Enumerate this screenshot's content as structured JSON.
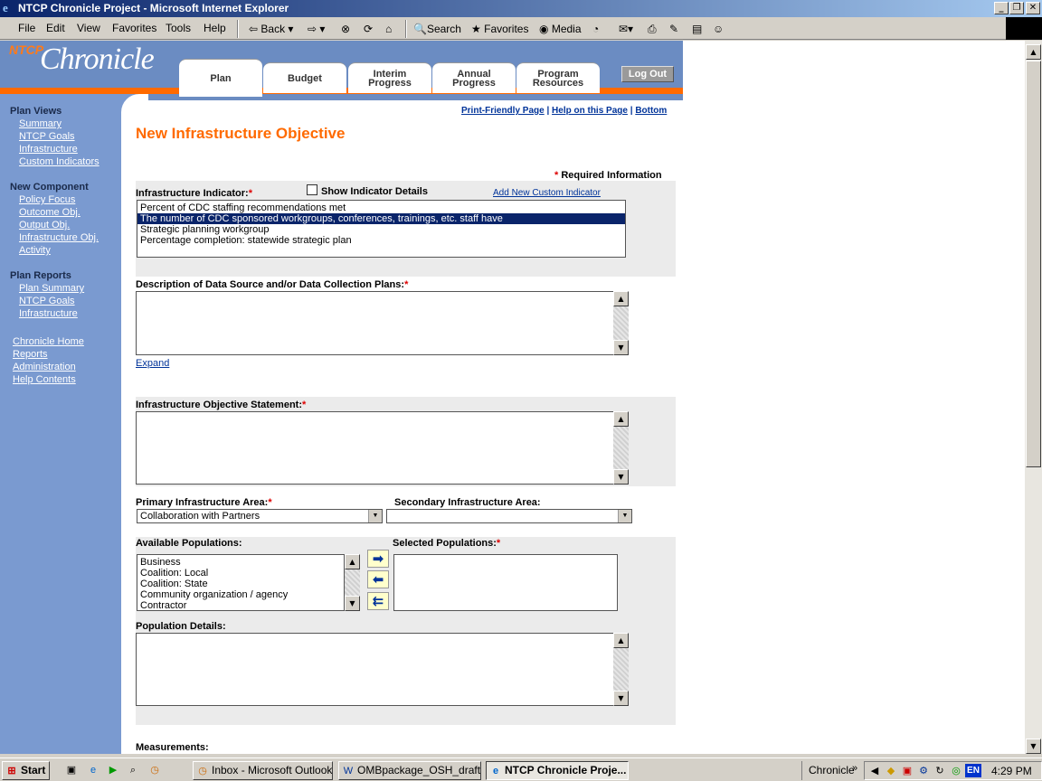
{
  "window": {
    "title": "NTCP Chronicle Project - Microsoft Internet Explorer"
  },
  "menu": [
    "File",
    "Edit",
    "View",
    "Favorites",
    "Tools",
    "Help"
  ],
  "toolbar": {
    "back": "Back",
    "search": "Search",
    "favorites": "Favorites",
    "media": "Media"
  },
  "header": {
    "logo_ntcp": "NTCP",
    "logo_chronicle": "Chronicle",
    "tabs": [
      {
        "line1": "Plan",
        "line2": ""
      },
      {
        "line1": "Budget",
        "line2": ""
      },
      {
        "line1": "Interim",
        "line2": "Progress"
      },
      {
        "line1": "Annual",
        "line2": "Progress"
      },
      {
        "line1": "Program",
        "line2": "Resources"
      }
    ],
    "logout": "Log Out"
  },
  "sidebar": {
    "plan_views": "Plan Views",
    "pv_items": [
      "Summary",
      "NTCP Goals",
      "Infrastructure",
      "Custom Indicators"
    ],
    "new_component": "New Component",
    "nc_items": [
      "Policy Focus",
      "Outcome Obj.",
      "Output Obj.",
      "Infrastructure Obj.",
      "Activity"
    ],
    "plan_reports": "Plan Reports",
    "pr_items": [
      "Plan Summary",
      "NTCP Goals",
      "Infrastructure"
    ],
    "bottom_items": [
      "Chronicle Home",
      "Reports",
      "Administration",
      "Help Contents"
    ]
  },
  "toplinks": {
    "print": "Print-Friendly Page",
    "help": "Help on this Page",
    "bottom": "Bottom"
  },
  "page": {
    "title": "New Infrastructure Objective",
    "required_info": "Required Information",
    "indicator_label": "Infrastructure Indicator:",
    "show_details": "Show Indicator Details",
    "add_custom": "Add New Custom Indicator",
    "indicators": [
      "Percent of CDC staffing recommendations met",
      "The number of CDC sponsored workgroups, conferences, trainings, etc. staff have",
      "Strategic planning workgroup",
      "Percentage completion: statewide strategic plan"
    ],
    "desc_label": "Description of Data Source and/or Data Collection Plans:",
    "expand": "Expand",
    "statement_label": "Infrastructure Objective Statement:",
    "primary_label": "Primary Infrastructure Area:",
    "primary_value": "Collaboration with Partners",
    "secondary_label": "Secondary Infrastructure Area:",
    "secondary_value": "",
    "available_label": "Available Populations:",
    "available": [
      "Business",
      "Coalition: Local",
      "Coalition: State",
      "Community organization / agency",
      "Contractor"
    ],
    "selected_label": "Selected Populations:",
    "pop_details_label": "Population Details:",
    "measurements_label": "Measurements:"
  },
  "taskbar": {
    "start": "Start",
    "tasks": [
      "Inbox - Microsoft Outlook",
      "OMBpackage_OSH_draft ...",
      "NTCP Chronicle Proje..."
    ],
    "tray_label": "Chronicle",
    "lang": "EN",
    "clock": "4:29 PM"
  }
}
